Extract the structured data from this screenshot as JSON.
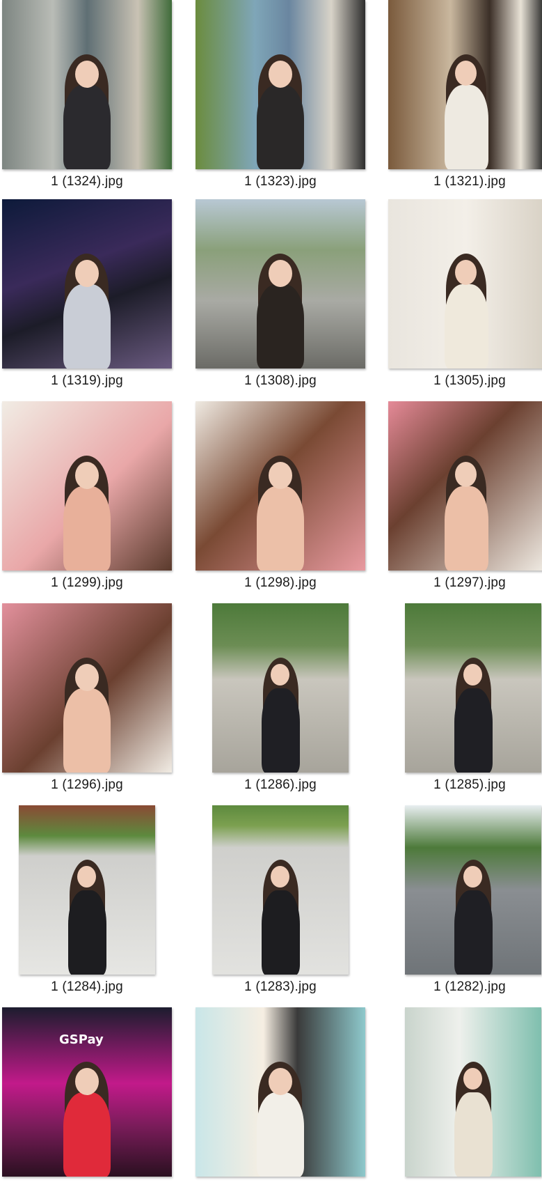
{
  "files": [
    {
      "name": "1 (1324).jpg",
      "shape": "sq",
      "bg": "linear-gradient(90deg,#7d8581 0%,#b9bcb6 30%,#5f6f74 50%,#c9c2b4 80%,#3f6b3a 100%)",
      "figure": "#2b2a2e"
    },
    {
      "name": "1 (1323).jpg",
      "shape": "sq",
      "bg": "linear-gradient(90deg,#6b8c3e 0%,#7fa6b8 35%,#6a86a0 55%,#d8d3c8 80%,#2e2e2e 100%)",
      "figure": "#2a2828"
    },
    {
      "name": "1 (1321).jpg",
      "shape": "sq",
      "bg": "linear-gradient(90deg,#7a5a3c 0%,#c9b79e 40%,#3b2f27 65%,#e8e2d6 85%,#2a2a2a 100%)",
      "figure": "#eeeae1"
    },
    {
      "name": "1 (1319).jpg",
      "shape": "sq",
      "bg": "linear-gradient(160deg,#0d1a3a 0%,#3a2a5a 40%,#1c1c28 60%,#6a5a80 100%)",
      "figure": "#c9cdd6"
    },
    {
      "name": "1 (1308).jpg",
      "shape": "sq",
      "bg": "linear-gradient(180deg,#b8c8d4 0%,#8aa07a 30%,#a9aaa4 60%,#6b6b66 100%)",
      "figure": "#2a2420"
    },
    {
      "name": "1 (1305).jpg",
      "shape": "sq",
      "bg": "linear-gradient(90deg,#e9e5de 0%,#f3efe8 50%,#d9d2c6 100%)",
      "figure": "#efe9dc"
    },
    {
      "name": "1 (1299).jpg",
      "shape": "sq",
      "bg": "linear-gradient(135deg,#f1ece4 0%,#e9a7a8 55%,#5a3a2c 100%)",
      "figure": "#e8b09a"
    },
    {
      "name": "1 (1298).jpg",
      "shape": "sq",
      "bg": "linear-gradient(135deg,#efeae2 0%,#7a4a34 45%,#e89aa0 100%)",
      "figure": "#ecc0a8"
    },
    {
      "name": "1 (1297).jpg",
      "shape": "sq",
      "bg": "linear-gradient(135deg,#e58a98 0%,#6b4030 40%,#efeae2 100%)",
      "figure": "#ecbfa7"
    },
    {
      "name": "1 (1296).jpg",
      "shape": "sq",
      "bg": "linear-gradient(315deg,#f1ece4 0%,#6b4030 45%,#e2909c 100%)",
      "figure": "#ecbfa7"
    },
    {
      "name": "1 (1286).jpg",
      "shape": "pt",
      "bg": "linear-gradient(180deg,#4d7a3a 0%,#6c8d54 25%,#c9c6bd 45%,#a7a49b 100%)",
      "figure": "#1f1f24"
    },
    {
      "name": "1 (1285).jpg",
      "shape": "pt",
      "bg": "linear-gradient(180deg,#4d7a3a 0%,#6c8d54 25%,#c9c6bd 45%,#a7a49b 100%)",
      "figure": "#1f1f24"
    },
    {
      "name": "1 (1284).jpg",
      "shape": "pt",
      "bg": "linear-gradient(180deg,#8a4a34 0%,#5d8a3e 18%,#cfcfcc 30%,#e6e6e3 100%)",
      "figure": "#1d1d20"
    },
    {
      "name": "1 (1283).jpg",
      "shape": "pt",
      "bg": "linear-gradient(180deg,#5d8a3e 0%,#7ca050 12%,#cfcfcc 25%,#e2e2df 100%)",
      "figure": "#1d1d20"
    },
    {
      "name": "1 (1282).jpg",
      "shape": "pt",
      "bg": "linear-gradient(180deg,#e8eef0 0%,#4d7a3a 25%,#8a8e92 50%,#6f7478 100%)",
      "figure": "#1f1f24"
    },
    {
      "name": "",
      "shape": "sq",
      "bg": "linear-gradient(180deg,#1c1c2e 0%,#c21a8a 45%,#7a1c5a 70%,#2a1020 100%)",
      "figure": "#e02a3a",
      "overlay": "GSPay"
    },
    {
      "name": "",
      "shape": "sq",
      "bg": "linear-gradient(90deg,#c9e6e8 0%,#f6eee2 40%,#3a3a3a 60%,#8ec9cc 100%)",
      "figure": "#f2efe8"
    },
    {
      "name": "",
      "shape": "pt",
      "bg": "linear-gradient(90deg,#c9d4cc 0%,#eef0ec 40%,#7fbfae 100%)",
      "figure": "#e9e1d2"
    }
  ]
}
